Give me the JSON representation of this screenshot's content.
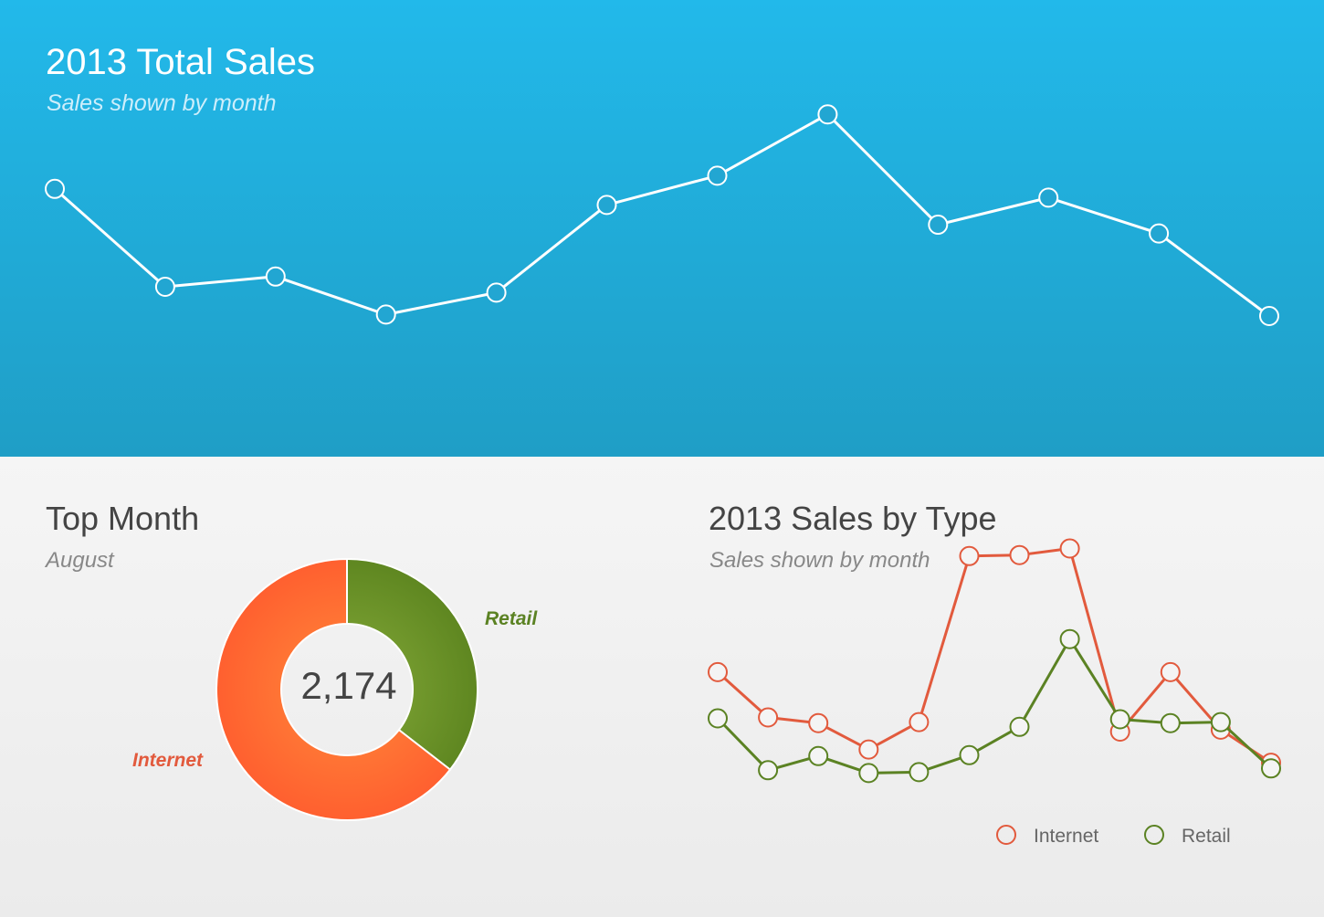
{
  "top": {
    "title": "2013 Total Sales",
    "subtitle": "Sales shown by month"
  },
  "top_month": {
    "title": "Top Month",
    "subtitle": "August"
  },
  "sales_type": {
    "title": "2013 Sales by Type",
    "subtitle": "Sales shown by month"
  },
  "colors": {
    "top_bg_start": "#22b9ea",
    "top_bg_end": "#1f9ec6",
    "internet": "#e25a3d",
    "retail": "#5b8223",
    "donut_internet": "#ff6a30",
    "donut_retail": "#6b9426"
  },
  "chart_data": [
    {
      "type": "line",
      "title": "2013 Total Sales",
      "subtitle": "Sales shown by month",
      "x": [
        1,
        2,
        3,
        4,
        5,
        6,
        7,
        8,
        9,
        10,
        11,
        12
      ],
      "values": [
        3540,
        2200,
        2340,
        1820,
        2120,
        3320,
        3720,
        4560,
        3050,
        3420,
        2930,
        1800
      ],
      "ylim": [
        0,
        6000
      ],
      "grid": false,
      "legend": "none"
    },
    {
      "type": "pie",
      "title": "Top Month",
      "subtitle": "August",
      "center_label": "2,174",
      "labels": [
        "Retail",
        "Internet"
      ],
      "values": [
        35.5,
        64.5
      ],
      "legend": "none"
    },
    {
      "type": "line",
      "title": "2013 Sales by Type",
      "subtitle": "Sales shown by month",
      "x": [
        1,
        2,
        3,
        4,
        5,
        6,
        7,
        8,
        9,
        10,
        11,
        12
      ],
      "series": [
        {
          "name": "Internet",
          "values": [
            1540,
            1060,
            1000,
            720,
            1010,
            2770,
            2780,
            2850,
            910,
            1540,
            930,
            580
          ]
        },
        {
          "name": "Retail",
          "values": [
            1050,
            500,
            650,
            470,
            480,
            660,
            960,
            1890,
            1040,
            1000,
            1010,
            520
          ]
        }
      ],
      "ylim": [
        0,
        3000
      ],
      "grid": false,
      "legend": "bottom-right"
    }
  ]
}
